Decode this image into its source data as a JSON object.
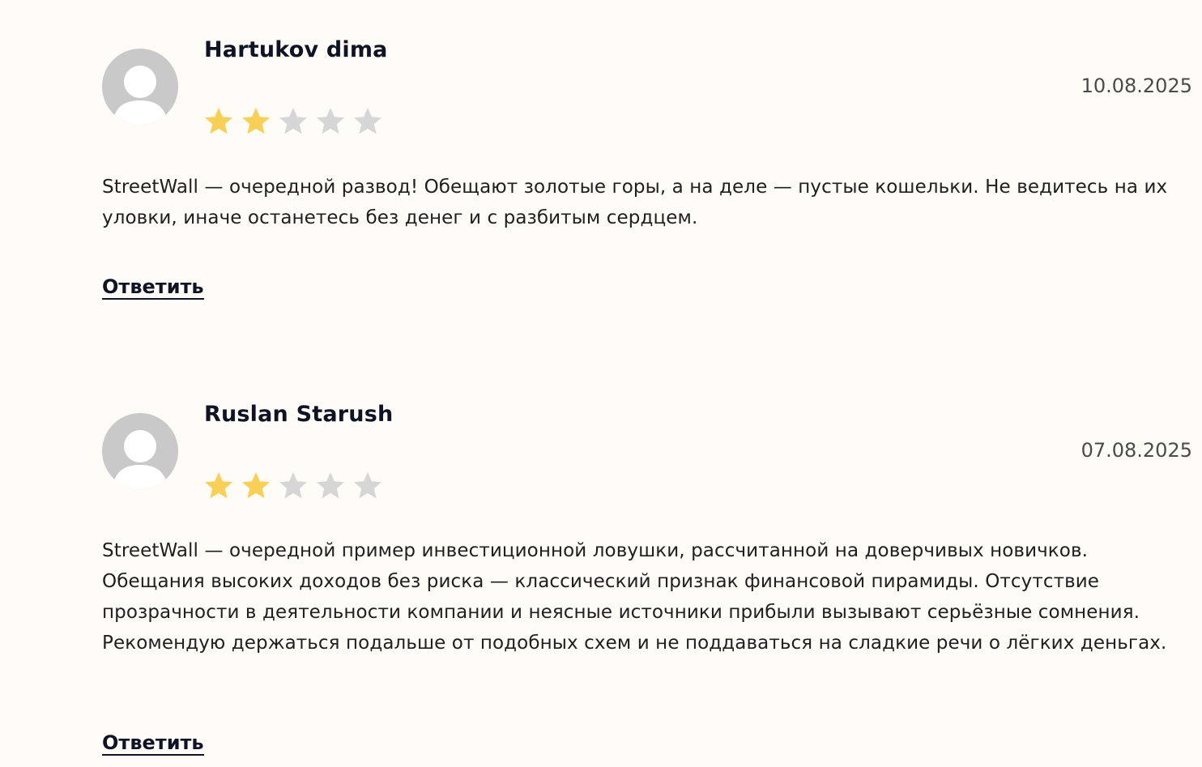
{
  "reviews": [
    {
      "author": "Hartukov dima",
      "date": "10.08.2025",
      "rating": 2,
      "rating_max": 5,
      "text": "StreetWall — очередной развод! Обещают золотые горы, а на деле — пустые кошельки. Не ведитесь на их уловки, иначе останетесь без денег и с разбитым сердцем.",
      "reply_label": "Ответить"
    },
    {
      "author": "Ruslan Starush",
      "date": "07.08.2025",
      "rating": 2,
      "rating_max": 5,
      "text": "StreetWall — очередной пример инвестиционной ловушки, рассчитанной на доверчивых новичков. Обещания высоких доходов без риска — классический признак финансовой пирамиды. Отсутствие прозрачности в деятельности компании и неясные источники прибыли вызывают серьёзные сомнения. Рекомендую держаться подальше от подобных схем и не поддаваться на сладкие речи о лёгких деньгах.",
      "reply_label": "Ответить"
    }
  ],
  "colors": {
    "background": "#fffbf7",
    "star_filled": "#f9d057",
    "star_empty": "#d6d6d6",
    "avatar": "#c9c9c9",
    "text_dark": "#0f1424"
  },
  "icons": {
    "avatar": "user-placeholder-icon",
    "star_filled": "star-filled-icon",
    "star_empty": "star-empty-icon"
  }
}
